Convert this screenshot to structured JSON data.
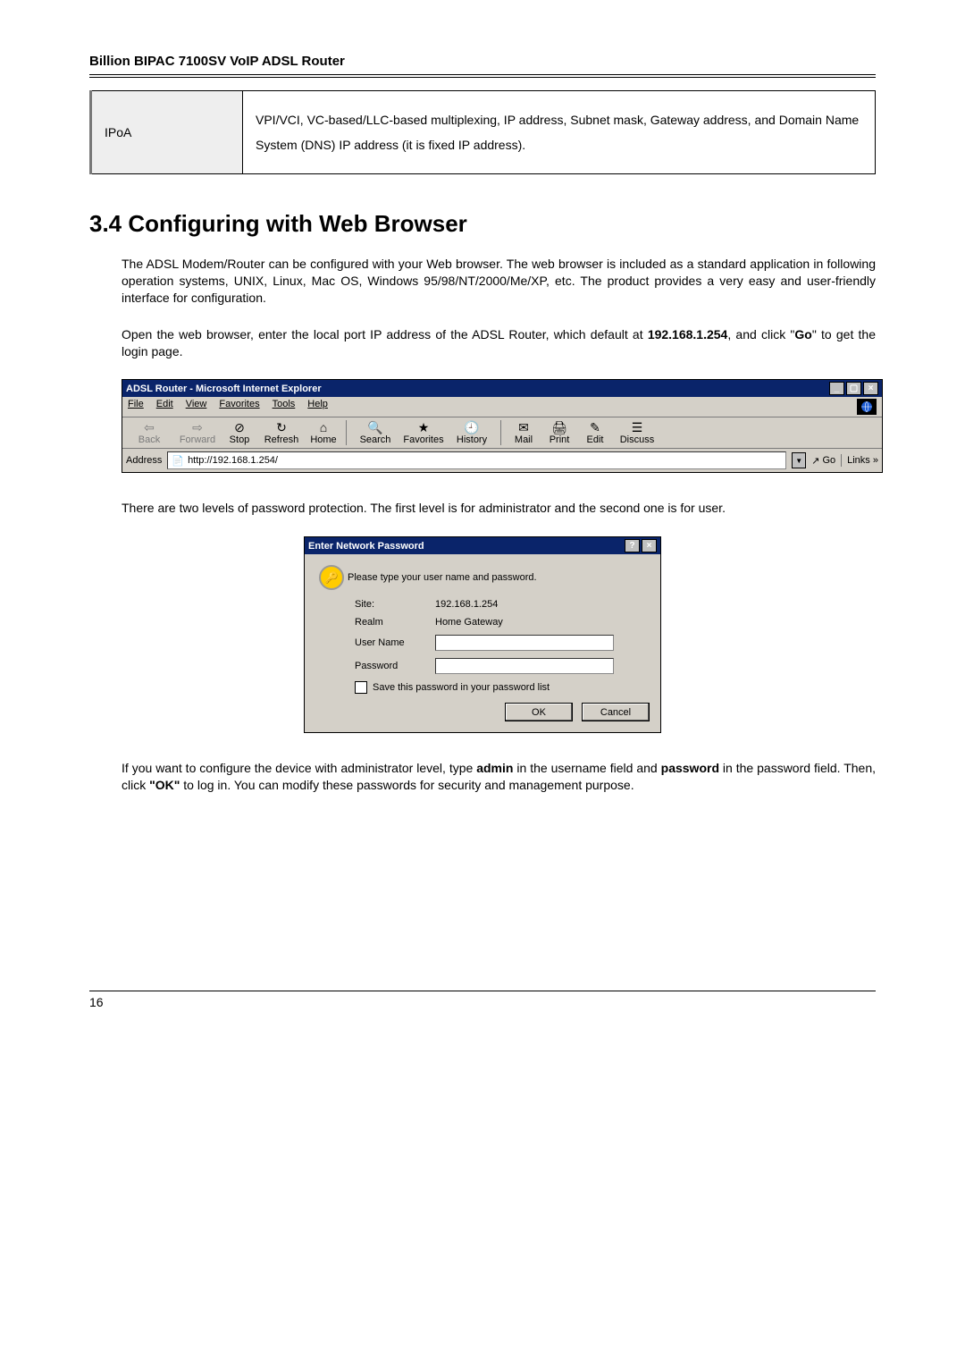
{
  "header": {
    "title": "Billion BIPAC 7100SV VoIP ADSL Router"
  },
  "ipoa_table": {
    "label": "IPoA",
    "desc": "VPI/VCI, VC-based/LLC-based multiplexing, IP address, Subnet mask, Gateway address, and Domain Name System (DNS) IP address (it is fixed IP address)."
  },
  "section": {
    "number_title": "3.4 Configuring with Web Browser",
    "para1": "The ADSL Modem/Router can be configured with your Web browser.  The web browser is included as a standard application in following operation systems, UNIX, Linux, Mac OS, Windows 95/98/NT/2000/Me/XP, etc. The product provides a very easy and user-friendly interface for configuration.",
    "para2_pre": "Open the web browser, enter the local port IP address of the ADSL Router, which default at ",
    "default_ip": "192.168.1.254",
    "para2_mid": ", and click \"",
    "go_word": "Go",
    "para2_post": "\" to get the login page.",
    "para3": "There are two levels of password protection. The first level is for administrator and the second one is for user.",
    "para4_pre": "If you want to configure the device with administrator level, type ",
    "admin_word": "admin",
    "para4_mid1": " in the username field and ",
    "password_word": "password",
    "para4_mid2": " in the password field. Then, click ",
    "ok_word": "\"OK\"",
    "para4_post": " to log in. You can modify these passwords for security and management purpose."
  },
  "ie": {
    "title": "ADSL Router - Microsoft Internet Explorer",
    "menu": {
      "file": "File",
      "edit": "Edit",
      "view": "View",
      "favorites": "Favorites",
      "tools": "Tools",
      "help": "Help"
    },
    "tools": {
      "back": "Back",
      "forward": "Forward",
      "stop": "Stop",
      "refresh": "Refresh",
      "home": "Home",
      "search": "Search",
      "favorites_btn": "Favorites",
      "history": "History",
      "mail": "Mail",
      "print": "Print",
      "edit_btn": "Edit",
      "discuss": "Discuss"
    },
    "address_label": "Address",
    "address_value": "http://192.168.1.254/",
    "go": "Go",
    "links": "Links"
  },
  "dialog": {
    "title": "Enter Network Password",
    "prompt": "Please type your user name and password.",
    "site_label": "Site:",
    "site_value": "192.168.1.254",
    "realm_label": "Realm",
    "realm_value": "Home Gateway",
    "username_label": "User Name",
    "password_label": "Password",
    "save_label": "Save this password in your password list",
    "ok": "OK",
    "cancel": "Cancel"
  },
  "footer": {
    "page_number": "16"
  }
}
